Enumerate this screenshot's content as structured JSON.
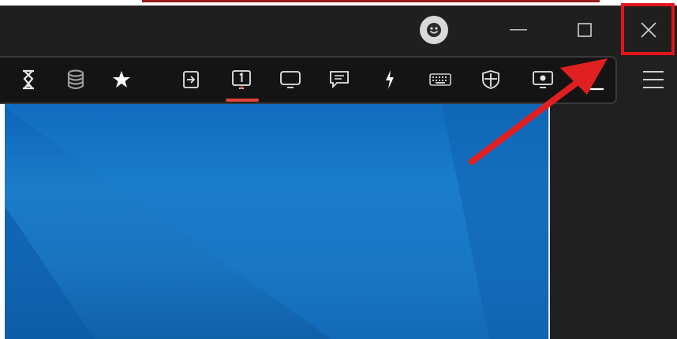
{
  "window": {
    "controls": [
      {
        "name": "avatar",
        "icon": "user-avatar-icon"
      },
      {
        "name": "minimize",
        "icon": "minimize-icon"
      },
      {
        "name": "maximize",
        "icon": "maximize-icon"
      },
      {
        "name": "close",
        "icon": "close-icon",
        "highlighted": true
      }
    ]
  },
  "toolbar": {
    "tools": [
      {
        "icon": "hourglass-icon"
      },
      {
        "icon": "database-icon"
      },
      {
        "icon": "star-icon"
      },
      {
        "icon": "file-transfer-icon"
      },
      {
        "icon": "monitor-1-icon",
        "label": "1",
        "active": true
      },
      {
        "icon": "monitor-icon"
      },
      {
        "icon": "chat-icon"
      },
      {
        "icon": "lightning-icon"
      },
      {
        "icon": "keyboard-icon"
      },
      {
        "icon": "shield-icon"
      },
      {
        "icon": "record-icon"
      },
      {
        "icon": "minimize-session-icon"
      }
    ],
    "menu_icon": "hamburger-menu-icon"
  },
  "annotation": {
    "highlight_color": "#e3141b",
    "arrow_color": "#e02020"
  },
  "colors": {
    "titlebar": "#1f1f1f",
    "toolbar": "#141414",
    "active_underline": "#e0443a",
    "desktop_blue": "#1a73bf"
  }
}
